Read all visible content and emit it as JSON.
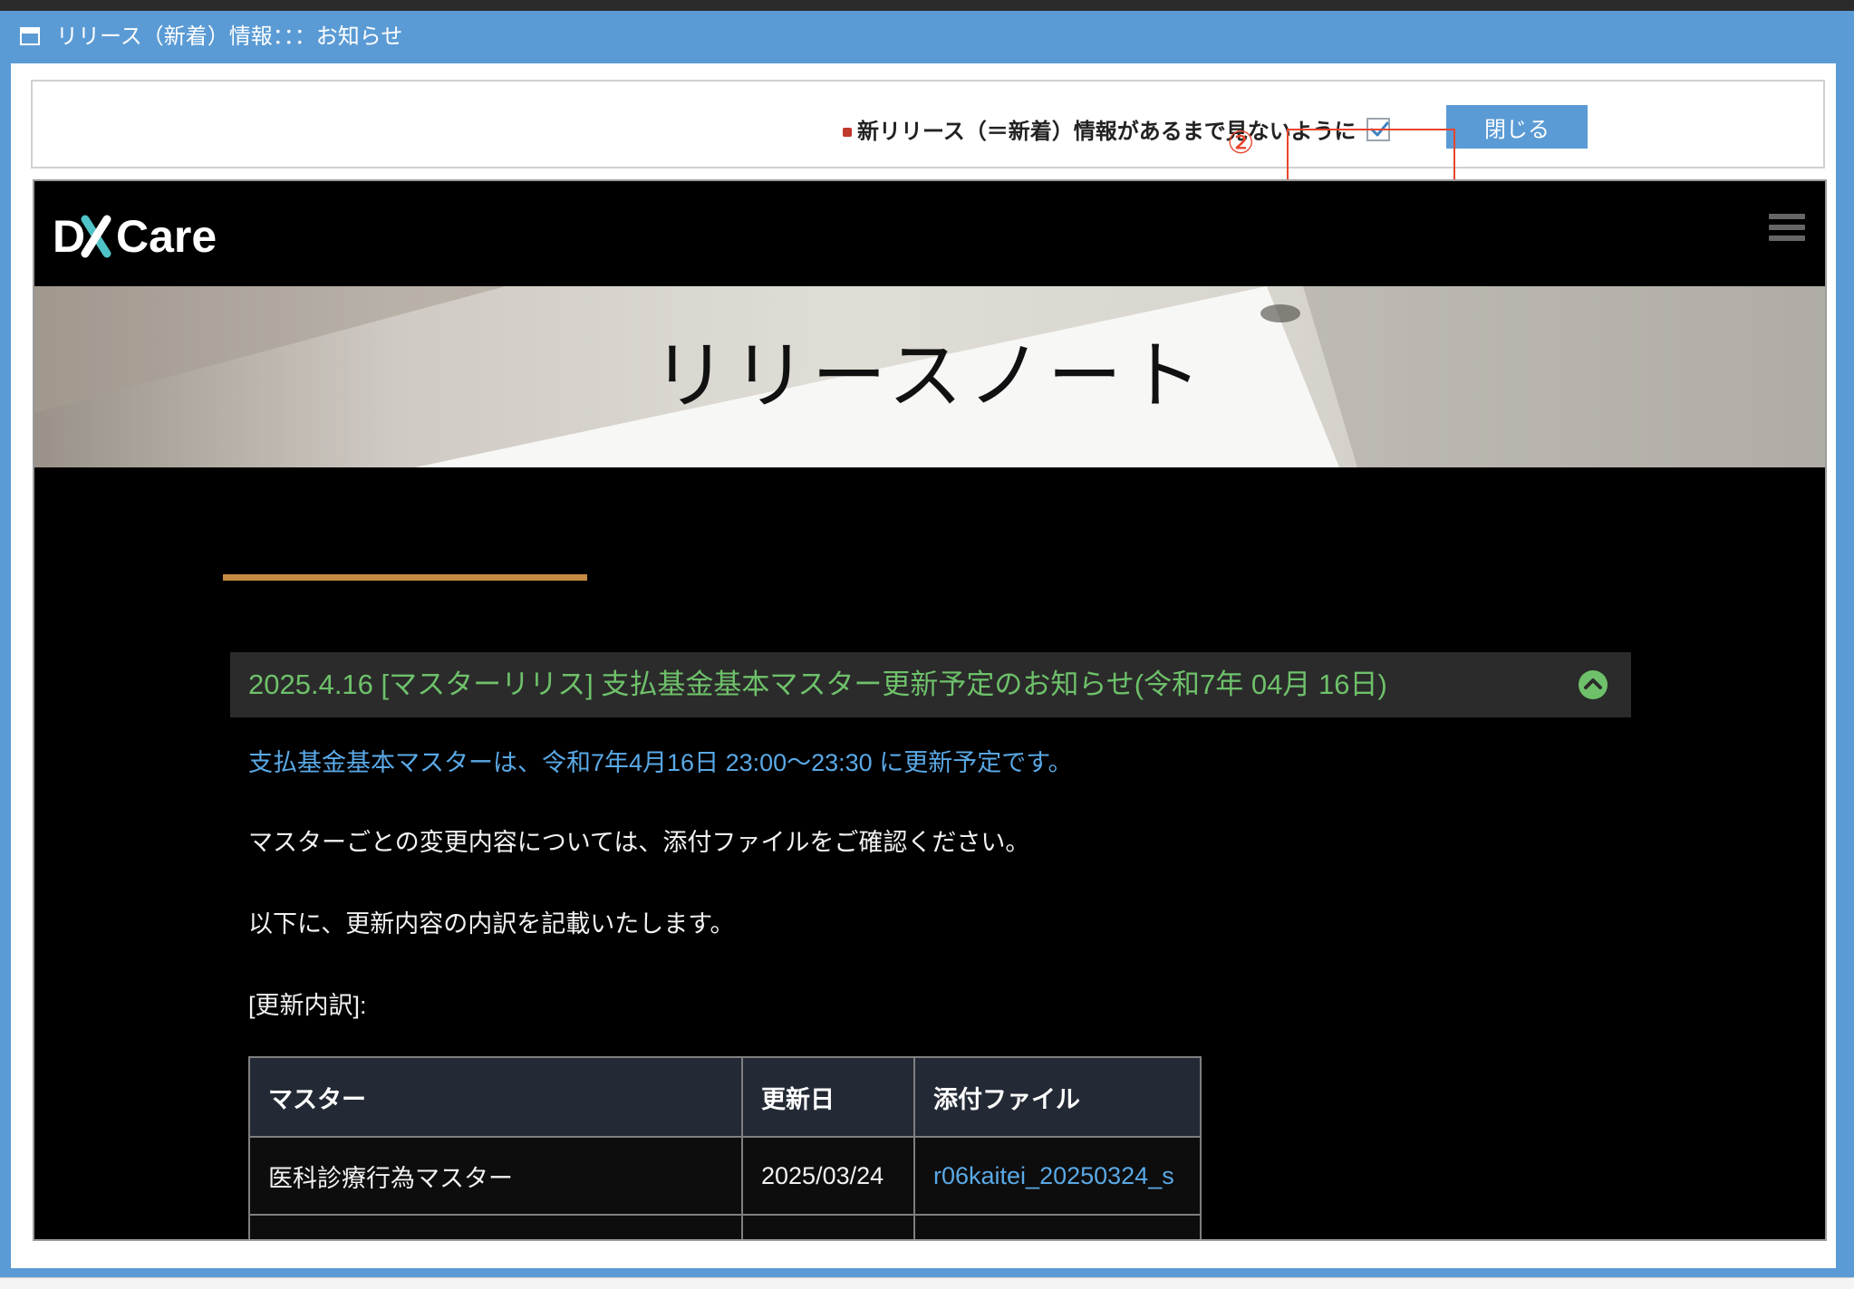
{
  "window": {
    "title": "リリース（新着）情報：：：お知らせ"
  },
  "controls": {
    "nohide_label": "新リリース（＝新着）情報があるまで見ないように",
    "checkbox_checked": true,
    "close_label": "閉じる",
    "annotation_number": "②",
    "annotation_color": "#e8452e"
  },
  "site": {
    "logo_text_a": "D",
    "logo_text_b": "Care",
    "hero_title": "リリースノート",
    "accent_color": "#c48b43"
  },
  "notice": {
    "title": "2025.4.16 [マスターリリス] 支払基金基本マスター更新予定のお知らせ(令和7年 04月 16日)",
    "expanded": true,
    "paragraphs": [
      "支払基金基本マスターは、令和7年4月16日 23:00〜23:30 に更新予定です。",
      "マスターごとの変更内容については、添付ファイルをご確認ください。",
      "以下に、更新内容の内訳を記載いたします。",
      "[更新内訳]:"
    ],
    "table": {
      "headers": [
        "マスター",
        "更新日",
        "添付ファイル"
      ],
      "rows": [
        [
          "医科診療行為マスター",
          "2025/03/24",
          "r06kaitei_20250324_s"
        ]
      ]
    }
  }
}
